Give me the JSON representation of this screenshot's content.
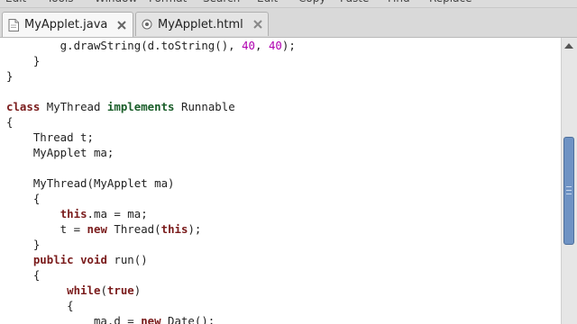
{
  "menubar": {
    "items": [
      "Edit",
      "Tools",
      "Window",
      "Format",
      "Search",
      "Edit",
      "Copy",
      "Paste",
      "Find",
      "Replace"
    ]
  },
  "tabs": [
    {
      "label": "MyApplet.java",
      "active": true
    },
    {
      "label": "MyApplet.html",
      "active": false
    }
  ],
  "colors": {
    "keyword": "#7a1b1b",
    "type_keyword": "#1a5e2a",
    "number": "#b000b0",
    "scroll_thumb": "#6f93c4"
  },
  "code": {
    "lines": [
      {
        "segments": [
          {
            "t": "        g.drawString(d.toString(), "
          },
          {
            "t": "40",
            "c": "num"
          },
          {
            "t": ", "
          },
          {
            "t": "40",
            "c": "num"
          },
          {
            "t": ");"
          }
        ]
      },
      {
        "segments": [
          {
            "t": "    }"
          }
        ]
      },
      {
        "segments": [
          {
            "t": "}"
          }
        ]
      },
      {
        "segments": [
          {
            "t": ""
          }
        ]
      },
      {
        "segments": [
          {
            "t": "class",
            "c": "kw"
          },
          {
            "t": " MyThread "
          },
          {
            "t": "implements",
            "c": "typ"
          },
          {
            "t": " Runnable"
          }
        ]
      },
      {
        "segments": [
          {
            "t": "{"
          }
        ]
      },
      {
        "segments": [
          {
            "t": "    Thread t;"
          }
        ]
      },
      {
        "segments": [
          {
            "t": "    MyApplet ma;"
          }
        ]
      },
      {
        "segments": [
          {
            "t": ""
          }
        ]
      },
      {
        "segments": [
          {
            "t": "    MyThread(MyApplet ma)"
          }
        ]
      },
      {
        "segments": [
          {
            "t": "    {"
          }
        ]
      },
      {
        "segments": [
          {
            "t": "        "
          },
          {
            "t": "this",
            "c": "kw"
          },
          {
            "t": ".ma = ma;"
          }
        ]
      },
      {
        "segments": [
          {
            "t": "        t = "
          },
          {
            "t": "new",
            "c": "kw"
          },
          {
            "t": " Thread("
          },
          {
            "t": "this",
            "c": "kw"
          },
          {
            "t": ");"
          }
        ]
      },
      {
        "segments": [
          {
            "t": "    }"
          }
        ]
      },
      {
        "segments": [
          {
            "t": "    "
          },
          {
            "t": "public",
            "c": "kw"
          },
          {
            "t": " "
          },
          {
            "t": "void",
            "c": "kw"
          },
          {
            "t": " run()"
          }
        ]
      },
      {
        "segments": [
          {
            "t": "    {"
          }
        ]
      },
      {
        "segments": [
          {
            "t": "         "
          },
          {
            "t": "while",
            "c": "kw"
          },
          {
            "t": "("
          },
          {
            "t": "true",
            "c": "kw"
          },
          {
            "t": ")"
          }
        ]
      },
      {
        "segments": [
          {
            "t": "         {"
          }
        ]
      },
      {
        "segments": [
          {
            "t": "             ma.d = "
          },
          {
            "t": "new",
            "c": "kw"
          },
          {
            "t": " Date();"
          }
        ]
      }
    ]
  }
}
